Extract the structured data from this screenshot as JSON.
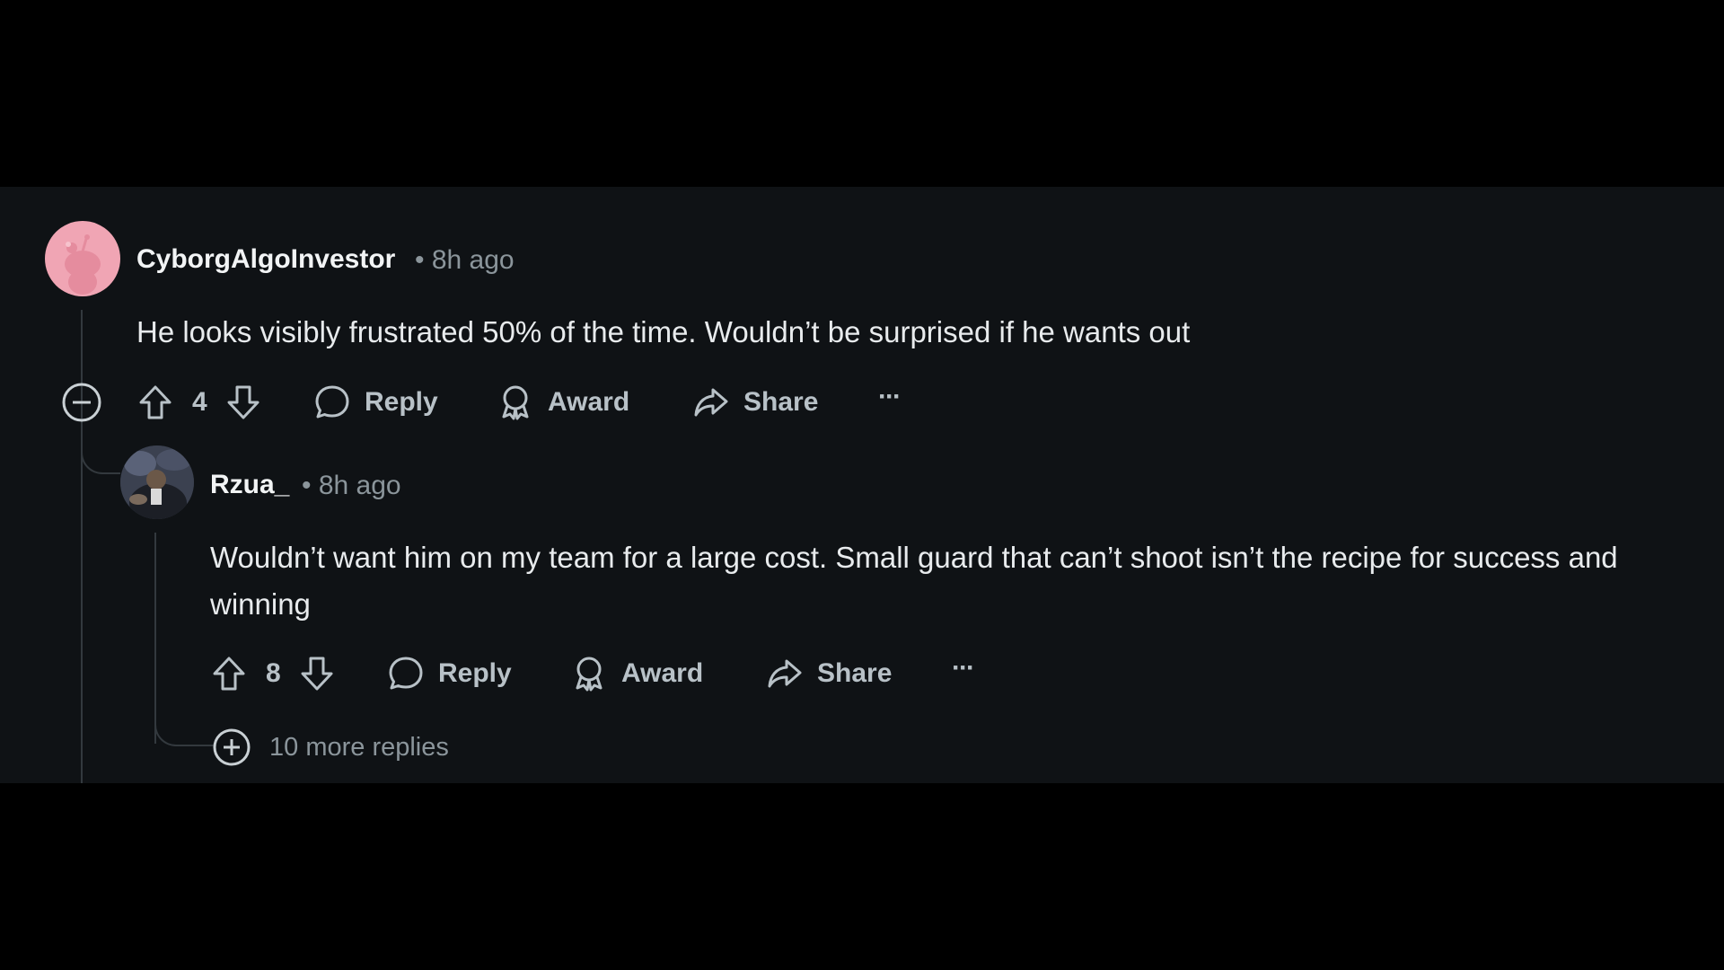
{
  "comments": [
    {
      "username": "CyborgAlgoInvestor",
      "time": "• 8h ago",
      "text": "He looks visibly frustrated 50% of the time. Wouldn’t be surprised if he wants out",
      "score": "4",
      "reply_label": "Reply",
      "award_label": "Award",
      "share_label": "Share",
      "more_label": "···"
    },
    {
      "username": "Rzua_",
      "time": "• 8h ago",
      "text": "Wouldn’t want him on my team for a large cost. Small guard that can’t shoot isn’t the recipe for success and winning",
      "score": "8",
      "reply_label": "Reply",
      "award_label": "Award",
      "share_label": "Share",
      "more_label": "···"
    }
  ],
  "more_replies": "10 more replies",
  "colors": {
    "background": "#000000",
    "panel": "#0F1215",
    "text": "#E8EBED",
    "muted": "#8B959B",
    "avatar_pink": "#F0A5B4"
  }
}
